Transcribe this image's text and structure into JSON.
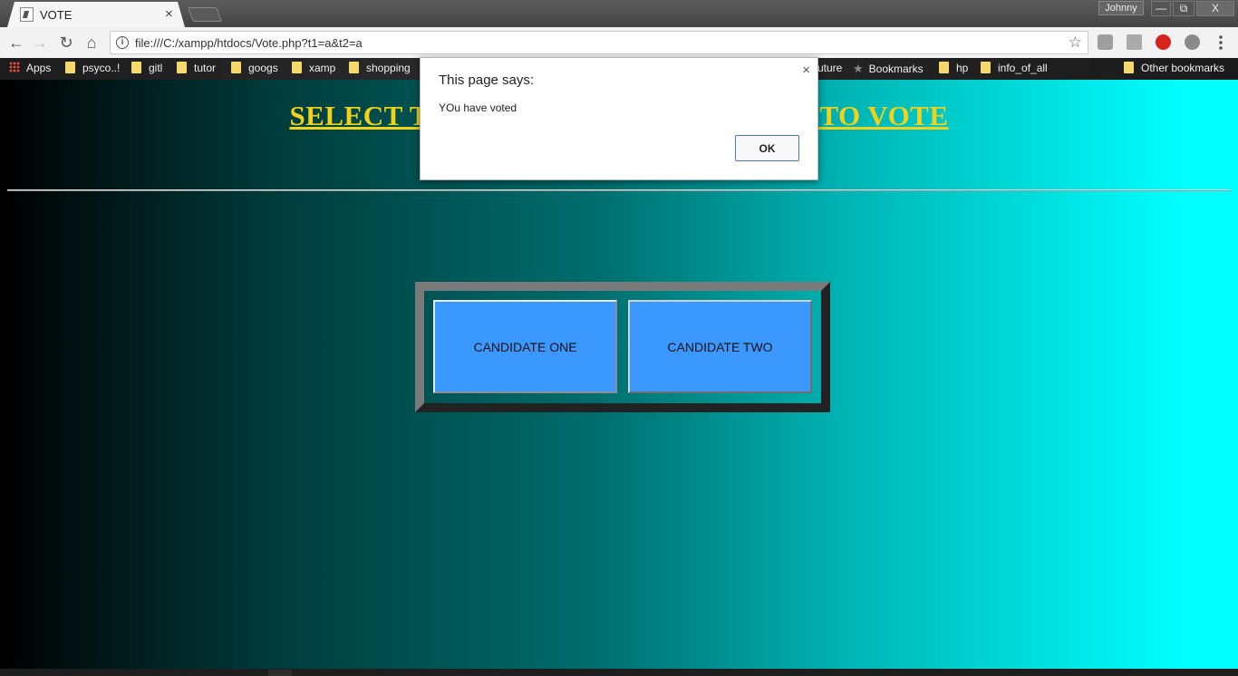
{
  "browser": {
    "tab_title": "VOTE",
    "tab_close": "×",
    "profile_name": "Johnny",
    "window_controls": {
      "minimize": "—",
      "maximize": "⧉",
      "close": "X"
    }
  },
  "toolbar": {
    "back": "←",
    "forward": "→",
    "reload": "↻",
    "home": "⌂",
    "info": "i",
    "url": "file:///C:/xampp/htdocs/Vote.php?t1=a&t2=a",
    "star": "☆"
  },
  "bookmarks": {
    "apps": "Apps",
    "items": [
      "psyco..!",
      "gitl",
      "tutor",
      "googs",
      "xamp",
      "shopping"
    ],
    "hidden_partial": "uture",
    "bookmarks_label": "Bookmarks",
    "more_items": [
      "hp",
      "info_of_all"
    ],
    "other": "Other bookmarks"
  },
  "page": {
    "heading": "SELECT THE CANDIDATE YOU WANT TO VOTE",
    "candidates": [
      "CANDIDATE ONE",
      "CANDIDATE TWO"
    ]
  },
  "dialog": {
    "title": "This page says:",
    "message": "YOu have voted",
    "ok_label": "OK",
    "close": "×"
  },
  "colors": {
    "heading": "#f0d21a",
    "button": "#3b98ff",
    "gradient_end": "#00ffff"
  }
}
